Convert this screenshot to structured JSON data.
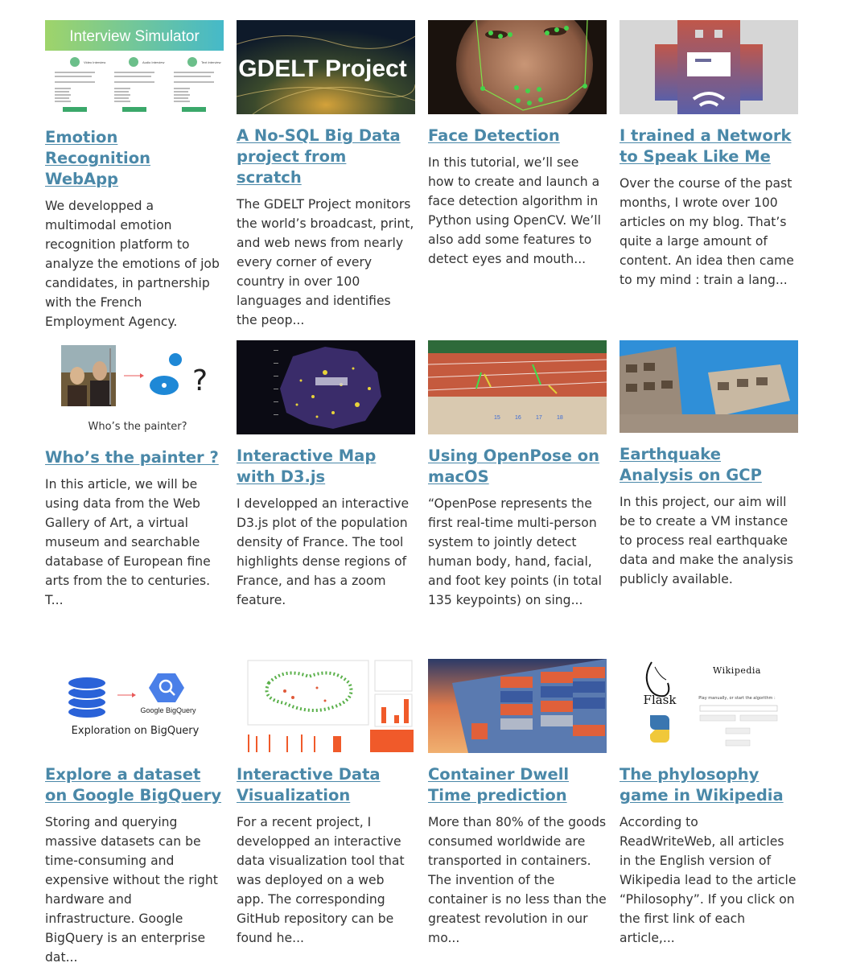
{
  "cards": [
    {
      "title": "Emotion Recognition WebApp",
      "desc": "We developped a multimodal emotion recognition platform to analyze the emotions of job candidates, in partnership with the French Employment Agency.",
      "thumb_text": "Interview Simulator",
      "thumb_cols": [
        "Video Interview",
        "Audio Interview",
        "Text Interview"
      ]
    },
    {
      "title": "A No-SQL Big Data project from scratch",
      "desc": "The GDELT Project monitors the world’s broadcast, print, and web news from nearly every corner of every country in over 100 languages and identifies the peop...",
      "thumb_text": "GDELT Project"
    },
    {
      "title": "Face Detection",
      "desc": "In this tutorial, we’ll see how to create and launch a face detection algorithm in Python using OpenCV. We’ll also add some features to detect eyes and mouth..."
    },
    {
      "title": "I trained a Network to Speak Like Me",
      "desc": "Over the course of the past months, I wrote over 100 articles on my blog. That’s quite a large amount of content. An idea then came to my mind : train a lang..."
    },
    {
      "title": "Who’s the painter ?",
      "desc": "In this article, we will be using data from the Web Gallery of Art, a virtual museum and searchable database of European fine arts from the to centuries. T...",
      "thumb_text": "Who’s the painter?"
    },
    {
      "title": "Interactive Map with D3.js",
      "desc": "I developped an interactive D3.js plot of the population density of France. The tool highlights dense regions of France, and has a zoom feature."
    },
    {
      "title": "Using OpenPose on macOS",
      "desc": "“OpenPose represents the first real-time multi-person system to jointly detect human body, hand, facial, and foot key points (in total 135 keypoints) on sing..."
    },
    {
      "title": "Earthquake Analysis on GCP",
      "desc": "In this project, our aim will be to create a VM instance to process real earthquake data and make the analysis publicly available."
    },
    {
      "title": "Explore a dataset on Google BigQuery",
      "desc": "Storing and querying massive datasets can be time-consuming and expensive without the right hardware and infrastructure. Google BigQuery is an enterprise dat...",
      "thumb_text": "Exploration on BigQuery",
      "thumb_label": "Google BigQuery"
    },
    {
      "title": "Interactive Data Visualization",
      "desc": "For a recent project, I developped an interactive data visualization tool that was deployed on a web app. The corresponding GitHub repository can be found he..."
    },
    {
      "title": "Container Dwell Time prediction",
      "desc": "More than 80% of the goods consumed worldwide are transported in containers. The invention of the container is no less than the greatest revolution in our mo..."
    },
    {
      "title": "The phylosophy game in Wikipedia",
      "desc": "According to ReadWriteWeb, all articles in the English version of Wikipedia lead to the article “Philosophy”. If you click on the first link of each article,...",
      "thumb_text": "Flask",
      "thumb_label": "Wikipedia",
      "thumb_sub": "Play manually, or start the algorithm :"
    }
  ]
}
